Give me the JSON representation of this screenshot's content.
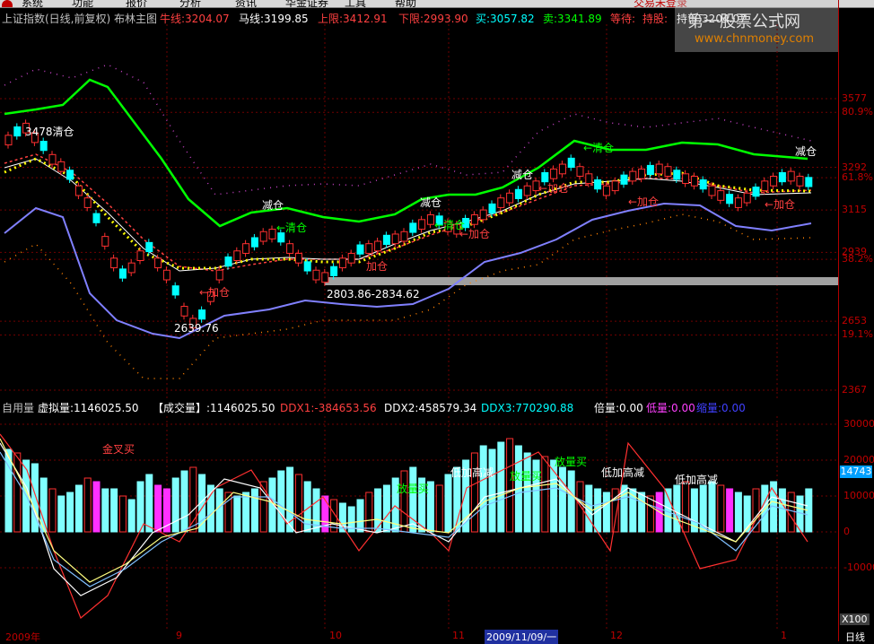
{
  "menu": {
    "logo_icon": "app-logo-icon",
    "items": [
      "系统",
      "功能",
      "报价",
      "分析",
      "资讯",
      "华金证券",
      "工具",
      "帮助"
    ],
    "right_title": "交易未登录"
  },
  "header_main": {
    "title": "上证指数(日线,前复权) 布林主图",
    "niu": "牛线:3204.07",
    "ma": "马线:3199.85",
    "upper": "上限:3412.91",
    "lower": "下限:2993.90",
    "buy": "买:3057.82",
    "sell": "卖:3341.89",
    "wait": "等待:",
    "hold": "持股:",
    "holdcoin": "持币:3204.07"
  },
  "watermark": {
    "line1": "第一股票公式网",
    "line2": "www.chnmoney.com"
  },
  "header_sub": {
    "name": "自用量",
    "virtual": "虚拟量:1146025.50",
    "volume": "【成交量】:1146025.50",
    "ddx1": "DDX1:-384653.56",
    "ddx2": "DDX2:458579.34",
    "ddx3": "DDX3:770290.88",
    "beiliang": "倍量:0.00",
    "diliang": "低量:0.00",
    "suoliang": "缩量:0.00"
  },
  "main_axis": [
    {
      "label": "3577",
      "value": 3577
    },
    {
      "label": "80.9%",
      "value": 3520
    },
    {
      "label": "3292",
      "value": 3292
    },
    {
      "label": "61.8%",
      "value": 3249
    },
    {
      "label": "3115",
      "value": 3115
    },
    {
      "label": "2939",
      "value": 2939
    },
    {
      "label": "38.2%",
      "value": 2910
    },
    {
      "label": "2653",
      "value": 2653
    },
    {
      "label": "19.1%",
      "value": 2596
    },
    {
      "label": "2367",
      "value": 2367
    }
  ],
  "sub_axis": [
    {
      "label": "30000",
      "value": 30000
    },
    {
      "label": "20000",
      "value": 20000
    },
    {
      "label": "14743",
      "value": 14743
    },
    {
      "label": "10000",
      "value": 10000
    },
    {
      "label": "0",
      "value": 0
    },
    {
      "label": "-10000",
      "value": -10000
    }
  ],
  "sub_scale": "X100",
  "period": "日线",
  "dates": [
    "2009年",
    "9",
    "10",
    "11",
    "2009/11/09/一",
    "12",
    "1"
  ],
  "annotations": {
    "peak_label": "3478清仓",
    "low_label": "2639.76",
    "range_label": "2803.86-2834.62",
    "actions": [
      {
        "text": "减仓",
        "color": "#ffffff"
      },
      {
        "text": "←清仓",
        "color": "#00ff00"
      },
      {
        "text": "←加仓",
        "color": "#ff4040"
      },
      {
        "text": "减仓",
        "color": "#ffffff"
      },
      {
        "text": "←清仓",
        "color": "#00ff00"
      },
      {
        "text": "←加仓",
        "color": "#ff4040"
      },
      {
        "text": "加仓",
        "color": "#ff4040"
      },
      {
        "text": "减仓",
        "color": "#ffffff"
      },
      {
        "text": "←加仓",
        "color": "#ff4040"
      },
      {
        "text": "←清仓",
        "color": "#00ff00"
      },
      {
        "text": "←加仓",
        "color": "#ff4040"
      },
      {
        "text": "减仓",
        "color": "#ffffff"
      },
      {
        "text": "←加仓",
        "color": "#ff4040"
      }
    ],
    "sub_labels": [
      {
        "text": "金叉买",
        "color": "#ff4040"
      },
      {
        "text": "放量买",
        "color": "#00ff00"
      },
      {
        "text": "低加高减",
        "color": "#ffffff"
      },
      {
        "text": "放量买",
        "color": "#00ff00"
      },
      {
        "text": "放量买",
        "color": "#00ff00"
      },
      {
        "text": "低加高减",
        "color": "#ffffff"
      },
      {
        "text": "低加高减",
        "color": "#ffffff"
      }
    ]
  },
  "colors": {
    "up": "#ff3030",
    "down": "#00ffff",
    "upper_band": "#00ff00",
    "lower_band": "#8080ff",
    "mid": "#ff4040",
    "ma_white": "#ffffff",
    "dots_yellow": "#ffff00",
    "cross_purple": "#c040c0",
    "cross_orange": "#ff8000",
    "axis_red": "#c00000"
  }
}
